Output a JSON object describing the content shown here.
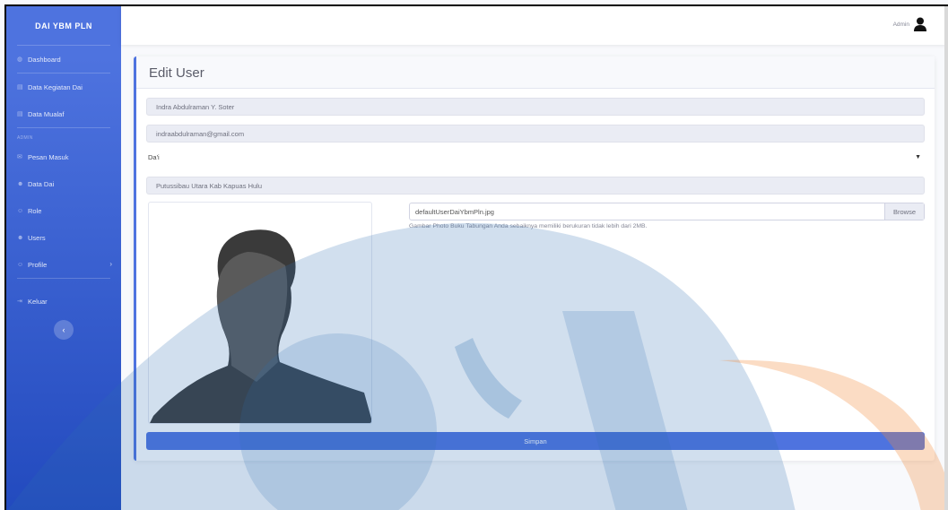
{
  "brand": "DAI YBM PLN",
  "sidebar": {
    "items": [
      {
        "label": "Dashboard",
        "icon": "dashboard-icon"
      },
      {
        "label": "Data Kegiatan Dai",
        "icon": "table-icon"
      },
      {
        "label": "Data Mualaf",
        "icon": "table-icon"
      },
      {
        "label": "Pesan Masuk",
        "icon": "envelope-icon"
      },
      {
        "label": "Data Dai",
        "icon": "users-icon"
      },
      {
        "label": "Role",
        "icon": "user-icon"
      },
      {
        "label": "Users",
        "icon": "users-icon"
      },
      {
        "label": "Profile",
        "icon": "user-icon"
      },
      {
        "label": "Keluar",
        "icon": "sign-out-icon"
      }
    ],
    "heading": "ADMIN",
    "toggle_glyph": "‹",
    "profile_chevron": "›"
  },
  "topbar": {
    "user_name": "Admin"
  },
  "form": {
    "title": "Edit User",
    "name_value": "Indra Abdulraman Y. Soter",
    "email_value": "indraabdulraman@gmail.com",
    "role_value": "Da'i",
    "address_value": "Putussibau Utara Kab Kapuas Hulu",
    "file_name": "defaultUserDaiYbmPln.jpg",
    "browse_label": "Browse",
    "help_text": "Gambar Photo Buku Tabungan Anda sebaiknya memiliki berukuran tidak lebih dari 2MB.",
    "submit_label": "Simpan"
  },
  "colors": {
    "primary": "#4e73df",
    "sidebar_dark": "#224abe",
    "watermark_blue": "#2e6fb0",
    "watermark_orange": "#f28c3a"
  }
}
